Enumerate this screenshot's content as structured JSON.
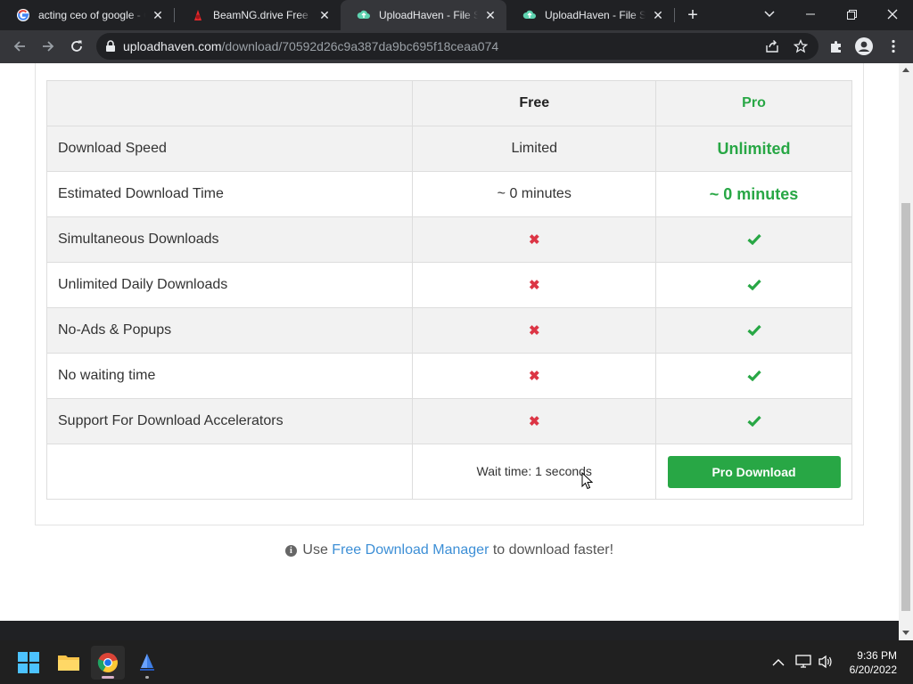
{
  "browser": {
    "tabs": [
      {
        "title": "acting ceo of google - Google Search",
        "favicon": "google-icon",
        "active": false
      },
      {
        "title": "BeamNG.drive Free Download",
        "favicon": "beamng-icon",
        "active": false
      },
      {
        "title": "UploadHaven - File Sharing",
        "favicon": "uploadhaven-icon",
        "active": true
      },
      {
        "title": "UploadHaven - File Sharing",
        "favicon": "uploadhaven-icon",
        "active": false
      }
    ],
    "address": {
      "host": "uploadhaven.com",
      "path": "/download/70592d26c9a387da9bc695f18ceaa074"
    }
  },
  "table": {
    "header": {
      "free": "Free",
      "pro": "Pro"
    },
    "rows": [
      {
        "feature": "Download Speed",
        "free": "Limited",
        "pro": "Unlimited"
      },
      {
        "feature": "Estimated Download Time",
        "free": "~ 0 minutes",
        "pro": "~ 0 minutes"
      },
      {
        "feature": "Simultaneous Downloads",
        "free": "✖",
        "pro": "check"
      },
      {
        "feature": "Unlimited Daily Downloads",
        "free": "✖",
        "pro": "check"
      },
      {
        "feature": "No-Ads & Popups",
        "free": "✖",
        "pro": "check"
      },
      {
        "feature": "No waiting time",
        "free": "✖",
        "pro": "check"
      },
      {
        "feature": "Support For Download Accelerators",
        "free": "✖",
        "pro": "check"
      }
    ],
    "wait_time": "Wait time: 1 seconds",
    "pro_button": "Pro Download"
  },
  "note": {
    "prefix": "Use",
    "link": "Free Download Manager",
    "suffix": "to download faster!"
  },
  "taskbar": {
    "time": "9:36 PM",
    "date": "6/20/2022"
  },
  "colors": {
    "pro_green": "#28a745",
    "cross_red": "#dc3545",
    "link_blue": "#3d8fd6"
  }
}
